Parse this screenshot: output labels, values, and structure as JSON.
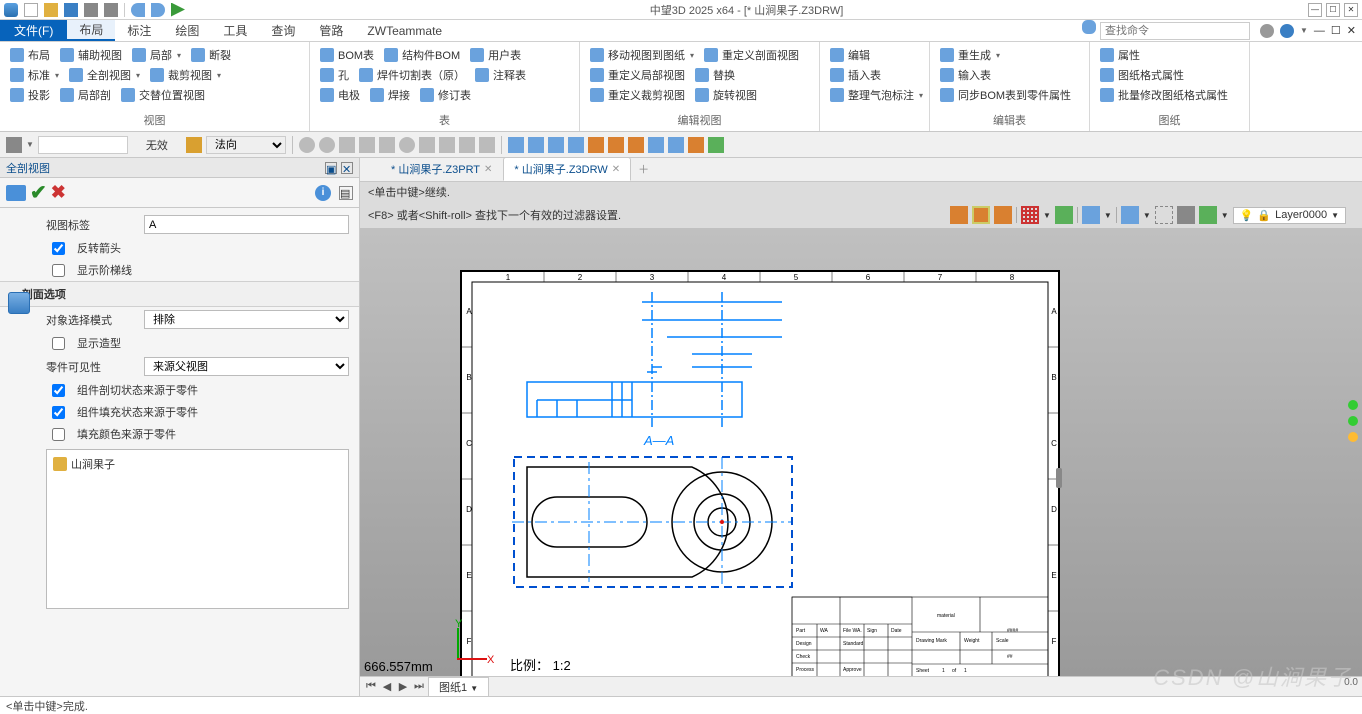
{
  "app": {
    "title": "中望3D 2025 x64 - [* 山涧果子.Z3DRW]"
  },
  "menu": {
    "file": "文件(F)",
    "tabs": [
      "布局",
      "标注",
      "绘图",
      "工具",
      "查询",
      "管路",
      "ZWTeammate"
    ],
    "active_tab": "布局",
    "search_placeholder": "查找命令"
  },
  "ribbon": {
    "g1": {
      "items": [
        [
          "布局",
          "辅助视图",
          "局部",
          "断裂"
        ],
        [
          "标准",
          "全剖视图",
          "裁剪视图",
          ""
        ],
        [
          "投影",
          "局部剖",
          "交替位置视图",
          ""
        ]
      ],
      "label": "视图"
    },
    "g2": {
      "items": [
        [
          "BOM表",
          "结构件BOM",
          "用户表"
        ],
        [
          "孔",
          "焊件切割表（原）",
          "注释表"
        ],
        [
          "电极",
          "焊接",
          "修订表"
        ]
      ],
      "label": "表"
    },
    "g3": {
      "items": [
        [
          "移动视图到图纸",
          "重定义剖面视图"
        ],
        [
          "重定义局部视图",
          "替换"
        ],
        [
          "重定义裁剪视图",
          "旋转视图"
        ]
      ],
      "label": "编辑视图"
    },
    "g4": {
      "items": [
        [
          "编辑"
        ],
        [
          "插入表"
        ],
        [
          "整理气泡标注"
        ]
      ],
      "label": ""
    },
    "g5": {
      "items": [
        [
          "重生成"
        ],
        [
          "输入表"
        ],
        [
          "同步BOM表到零件属性"
        ]
      ],
      "label": "编辑表"
    },
    "g6": {
      "items": [
        [
          "属性"
        ],
        [
          "图纸格式属性"
        ],
        [
          "批量修改图纸格式属性"
        ]
      ],
      "label": "图纸"
    }
  },
  "toolbar2": {
    "combo1": "",
    "label1": "无效",
    "combo2": "法向"
  },
  "panel": {
    "title": "全剖视图",
    "view_label_lbl": "视图标签",
    "view_label_val": "A",
    "reverse_arrow": "反转箭头",
    "show_step": "显示阶梯线",
    "section_hdr": "剖面选项",
    "obj_sel_lbl": "对象选择模式",
    "obj_sel_val": "排除",
    "show_shape": "显示造型",
    "part_vis_lbl": "零件可见性",
    "part_vis_val": "来源父视图",
    "chk1": "组件剖切状态来源于零件",
    "chk2": "组件填充状态来源于零件",
    "chk3": "填充颜色来源于零件",
    "tree_item": "山涧果子"
  },
  "docs": {
    "tab1": "* 山涧果子.Z3PRT",
    "tab2": "* 山涧果子.Z3DRW"
  },
  "hints": {
    "line1": "<单击中键>继续.",
    "line2": "<F8> 或者<Shift-roll> 查找下一个有效的过滤器设置."
  },
  "canvas": {
    "section_label": "A—A",
    "layer": "Layer0000",
    "coord": "666.557mm",
    "scale": "比例：   1:2",
    "x_label": "X",
    "y_label": "Y",
    "ruler_top": [
      "1",
      "2",
      "3",
      "4",
      "5",
      "6",
      "7",
      "8"
    ],
    "ruler_side": [
      "A",
      "B",
      "C",
      "D",
      "E",
      "F"
    ],
    "title_block": {
      "r1": [
        "Part",
        "WA",
        "File WA.",
        "Sign",
        "Date"
      ],
      "r2": [
        "Design",
        "",
        "Standard",
        "",
        "",
        "Drawing Mark",
        "Weight",
        "Scale"
      ],
      "r3": [
        "Check",
        "",
        "",
        "",
        "",
        "",
        "",
        ""
      ],
      "r4": [
        "Process",
        "",
        "",
        "",
        "",
        "Sheet",
        "1",
        "of",
        "1"
      ],
      "material": "material",
      "code": "####"
    }
  },
  "sheet_nav": {
    "sheet": "图纸1"
  },
  "status": "<单击中键>完成.",
  "watermark": "CSDN @山涧果子",
  "side_value": "0.0"
}
